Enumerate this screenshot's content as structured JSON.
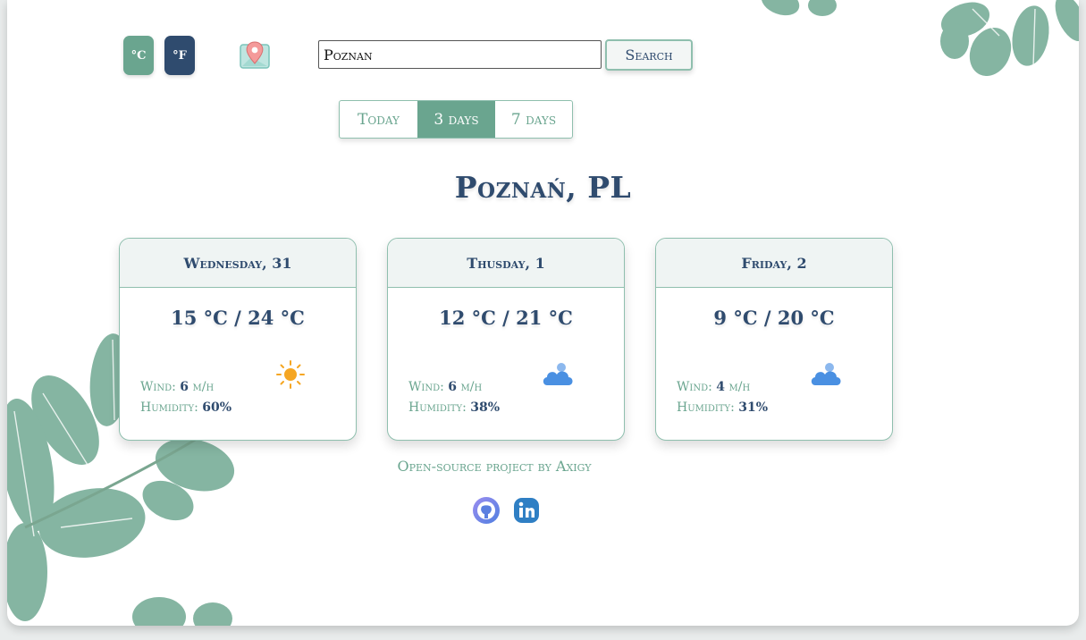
{
  "units": {
    "celsius_label": "°C",
    "fahrenheit_label": "°F",
    "active": "fahrenheit"
  },
  "location_icon": "map-pin-icon",
  "search": {
    "value": "Poznan",
    "button_label": "Search"
  },
  "tabs": [
    {
      "label": "Today",
      "active": false
    },
    {
      "label": "3 days",
      "active": true
    },
    {
      "label": "7 days",
      "active": false
    }
  ],
  "city": "Poznań, PL",
  "forecast": [
    {
      "day": "Wednesday, 31",
      "temp": "15 °C / 24 °C",
      "wind_label": "Wind:",
      "wind_value": "6",
      "wind_unit": "m/h",
      "humidity_label": "Humidity:",
      "humidity_value": "60%",
      "icon": "sun-icon"
    },
    {
      "day": "Thusday, 1",
      "temp": "12 °C / 21 °C",
      "wind_label": "Wind:",
      "wind_value": "6",
      "wind_unit": "m/h",
      "humidity_label": "Humidity:",
      "humidity_value": "38%",
      "icon": "cloud-icon"
    },
    {
      "day": "Friday, 2",
      "temp": "9 °C / 20 °C",
      "wind_label": "Wind:",
      "wind_value": "4",
      "wind_unit": "m/h",
      "humidity_label": "Humidity:",
      "humidity_value": "31%",
      "icon": "cloud-icon"
    }
  ],
  "footer": {
    "text": "Open-source project by Axigy"
  },
  "social": [
    {
      "icon": "github-icon"
    },
    {
      "icon": "linkedin-icon"
    }
  ],
  "colors": {
    "accent_green": "#6aa58f",
    "navy": "#2f4b6e",
    "border_green": "#8fbfae",
    "sun": "#f5a623",
    "cloud": "#4a90e2"
  }
}
